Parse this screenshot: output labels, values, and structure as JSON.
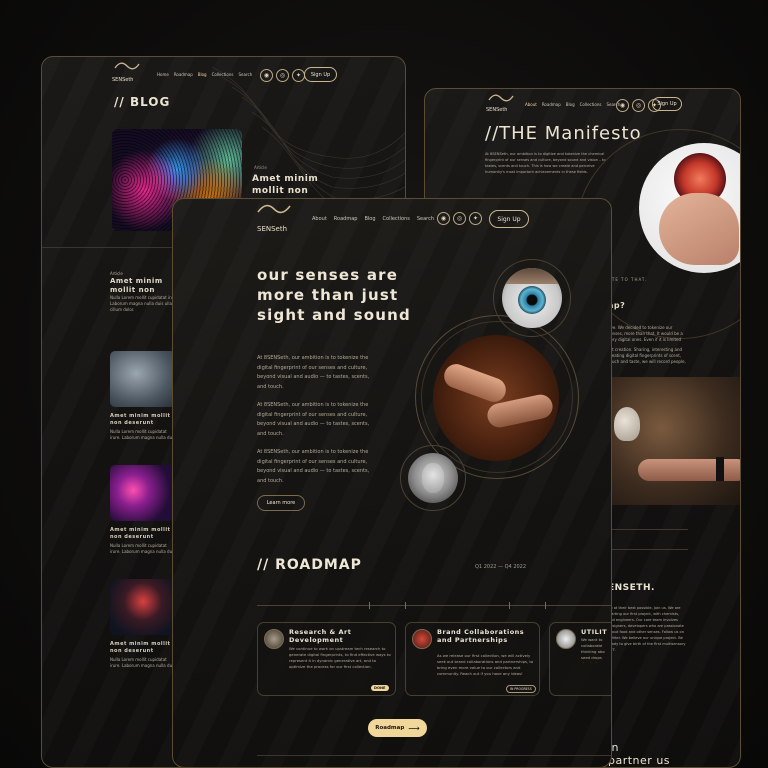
{
  "blog": {
    "logo": "SENSeth",
    "nav": [
      "Home",
      "Roadmap",
      "Blog",
      "Collections",
      "Search"
    ],
    "signup": "Sign Up",
    "title": "// BLOG",
    "feature_title": "Amet minim mollit non deserunt",
    "tag": "Article",
    "items": [
      {
        "title": "Amet minim mollit non deserunt ullamco"
      },
      {
        "title": "Amet minim mollit non deserunt ullamco"
      },
      {
        "title": "Amet minim mollit non deserunt ullamco"
      },
      {
        "title": "Amet minim mollit non deserunt ullamco"
      }
    ],
    "item_text": "Nulla Lorem mollit cupidatat irure. Laborum magna nulla duis ullamco cillum dolor."
  },
  "manifesto": {
    "logo": "SENSeth",
    "nav": [
      "About",
      "Roadmap",
      "Blog",
      "Collections",
      "Search"
    ],
    "signup": "Sign Up",
    "title": "//THE Manifesto",
    "intro": "At 8SENSeth, our ambition is to digitize and tokenize the chemical fingerprint of our senses and culture, beyond sound and vision – to tastes, scents and touch. This is how we create and perceive humanity's most important achievements in these fields.",
    "section_fragment": "ute to that.",
    "question": "ap?",
    "body": "ove. We decided to tokenize our senses, more than that. It would be a very digital ones. Even if it is limited to education, sound the smell.",
    "body2": "art creation. Sharing, interesting and creating digital fingerprints of scent, touch and taste, we will record people, food and cultural experience.",
    "brand_fragment": "ENSETH.",
    "brand_text": "ng at their best possible. Join us. We are starting our first project, with chemists, and engineers. Our core team involves designers, developers who are passionate about food and other senses. Follow us on Twitter. We believe our unique project. Be ready to give birth of the first multisensory NFT.",
    "join": "in",
    "partner": "partner us"
  },
  "main": {
    "logo": "SENSeth",
    "nav": [
      "About",
      "Roadmap",
      "Blog",
      "Collections",
      "Search"
    ],
    "signup": "Sign Up",
    "hero_title": "our senses are more than just sight and sound",
    "paragraphs": [
      "At 8SENSeth, our ambition is to tokenize the digital fingerprint of our senses and culture, beyond visual and audio — to tastes, scents, and touch.",
      "At 8SENSeth, our ambition is to tokenize the digital fingerprint of our senses and culture, beyond visual and audio — to tastes, scents, and touch.",
      "At 8SENSeth, our ambition is to tokenize the digital fingerprint of our senses and culture, beyond visual and audio — to tastes, scents, and touch."
    ],
    "learn_more": "Learn more",
    "roadmap_title": "// roadmap",
    "roadmap_range": "Q1 2022 — Q4 2022",
    "cards": [
      {
        "title": "Research & Art Development",
        "text": "We continue to work on upstream tech research to generate digital fingerprints, to find effective ways to represent it in dynamic generative art, and to optimize the process for our first collection.",
        "badge": "DONE"
      },
      {
        "title": "Brand Collaborations and Partnerships",
        "text": "As we release our first collection, we will actively seek out brand collaborations and partnerships, to bring even more value to our collectors and community. Reach out if you have any ideas!",
        "badge": "IN PROGRESS"
      },
      {
        "title": "UTILIT",
        "text": "We want to collaborate thinking abo seed drops physical wo"
      }
    ],
    "roadmap_button": "Roadmap"
  },
  "colors": {
    "accent": "#f1d79a",
    "gold_line": "#c9b68e",
    "bg": "#121110"
  }
}
